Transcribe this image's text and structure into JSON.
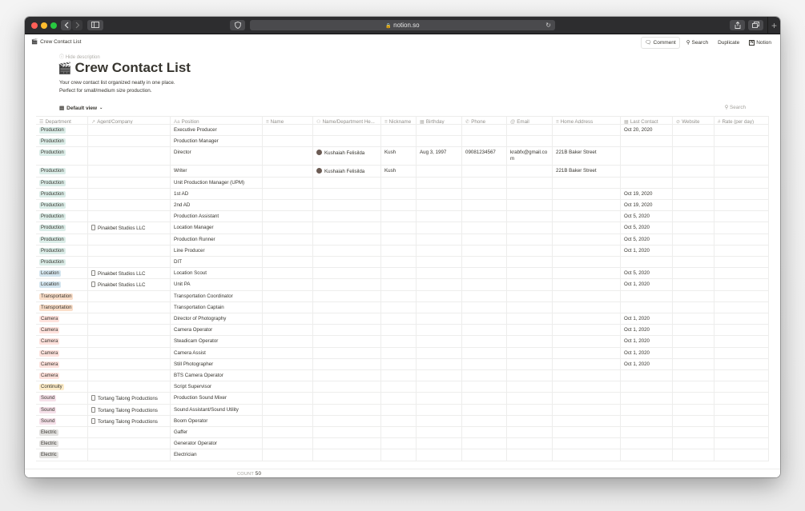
{
  "browser": {
    "url": "notion.so",
    "lock": "🔒"
  },
  "topbar": {
    "breadcrumb": "Crew Contact List",
    "breadcrumb_icon": "🎬",
    "comment": "Comment",
    "search": "Search",
    "duplicate": "Duplicate",
    "notion": "Notion"
  },
  "page": {
    "hide_description": "Hide description",
    "emoji": "🎬",
    "title": "Crew Contact List",
    "description_line1": "Your crew contact list organized neatly in one place.",
    "description_line2": "Perfect for small/medium size production.",
    "view": "Default view",
    "search": "Search"
  },
  "columns": [
    {
      "icon": "☰",
      "label": "Department"
    },
    {
      "icon": "↗",
      "label": "Agent/Company"
    },
    {
      "icon": "Aa",
      "label": "Position"
    },
    {
      "icon": "≡",
      "label": "Name"
    },
    {
      "icon": "⚇",
      "label": "Name/Department He..."
    },
    {
      "icon": "≡",
      "label": "Nickname"
    },
    {
      "icon": "▦",
      "label": "Birthday"
    },
    {
      "icon": "✆",
      "label": "Phone"
    },
    {
      "icon": "@",
      "label": "Email"
    },
    {
      "icon": "≡",
      "label": "Home Address"
    },
    {
      "icon": "▦",
      "label": "Last Contact"
    },
    {
      "icon": "⊘",
      "label": "Website"
    },
    {
      "icon": "#",
      "label": "Rate (per day)"
    }
  ],
  "rows": [
    {
      "dept": "Production",
      "dept_key": "production",
      "company": "",
      "position": "Executive Producer",
      "head": "",
      "nickname": "",
      "birthday": "",
      "phone": "",
      "email": "",
      "address": "",
      "last_contact": "Oct 20, 2020"
    },
    {
      "dept": "Production",
      "dept_key": "production",
      "company": "",
      "position": "Production Manager",
      "head": "",
      "nickname": "",
      "birthday": "",
      "phone": "",
      "email": "",
      "address": "",
      "last_contact": ""
    },
    {
      "dept": "Production",
      "dept_key": "production",
      "company": "",
      "position": "Director",
      "head": "Kushaiah Felisilda",
      "nickname": "Kush",
      "birthday": "Aug 3, 1997",
      "phone": "09081234567",
      "email": "krabfx@gmail.com",
      "address": "221B Baker Street",
      "last_contact": "",
      "tall": true
    },
    {
      "dept": "Production",
      "dept_key": "production",
      "company": "",
      "position": "Writer",
      "head": "Kushaiah Felisilda",
      "nickname": "Kush",
      "birthday": "",
      "phone": "",
      "email": "",
      "address": "221B Baker Street",
      "last_contact": ""
    },
    {
      "dept": "Production",
      "dept_key": "production",
      "company": "",
      "position": "Unit Production Manager (UPM)",
      "head": "",
      "nickname": "",
      "birthday": "",
      "phone": "",
      "email": "",
      "address": "",
      "last_contact": ""
    },
    {
      "dept": "Production",
      "dept_key": "production",
      "company": "",
      "position": "1st AD",
      "head": "",
      "nickname": "",
      "birthday": "",
      "phone": "",
      "email": "",
      "address": "",
      "last_contact": "Oct 19, 2020"
    },
    {
      "dept": "Production",
      "dept_key": "production",
      "company": "",
      "position": "2nd AD",
      "head": "",
      "nickname": "",
      "birthday": "",
      "phone": "",
      "email": "",
      "address": "",
      "last_contact": "Oct 19, 2020"
    },
    {
      "dept": "Production",
      "dept_key": "production",
      "company": "",
      "position": "Production Assistant",
      "head": "",
      "nickname": "",
      "birthday": "",
      "phone": "",
      "email": "",
      "address": "",
      "last_contact": "Oct 5, 2020"
    },
    {
      "dept": "Production",
      "dept_key": "production",
      "company": "Pinakbet Studios LLC",
      "position": "Location Manager",
      "head": "",
      "nickname": "",
      "birthday": "",
      "phone": "",
      "email": "",
      "address": "",
      "last_contact": "Oct 5, 2020"
    },
    {
      "dept": "Production",
      "dept_key": "production",
      "company": "",
      "position": "Production Runner",
      "head": "",
      "nickname": "",
      "birthday": "",
      "phone": "",
      "email": "",
      "address": "",
      "last_contact": "Oct 5, 2020"
    },
    {
      "dept": "Production",
      "dept_key": "production",
      "company": "",
      "position": "Line Producer",
      "head": "",
      "nickname": "",
      "birthday": "",
      "phone": "",
      "email": "",
      "address": "",
      "last_contact": "Oct 1, 2020"
    },
    {
      "dept": "Production",
      "dept_key": "production",
      "company": "",
      "position": "DIT",
      "head": "",
      "nickname": "",
      "birthday": "",
      "phone": "",
      "email": "",
      "address": "",
      "last_contact": ""
    },
    {
      "dept": "Location",
      "dept_key": "location",
      "company": "Pinakbet Studios LLC",
      "position": "Location Scout",
      "head": "",
      "nickname": "",
      "birthday": "",
      "phone": "",
      "email": "",
      "address": "",
      "last_contact": "Oct 5, 2020"
    },
    {
      "dept": "Location",
      "dept_key": "location",
      "company": "Pinakbet Studios LLC",
      "position": "Unit PA",
      "head": "",
      "nickname": "",
      "birthday": "",
      "phone": "",
      "email": "",
      "address": "",
      "last_contact": "Oct 1, 2020"
    },
    {
      "dept": "Transportation",
      "dept_key": "transportation",
      "company": "",
      "position": "Transportation Coordinator",
      "head": "",
      "nickname": "",
      "birthday": "",
      "phone": "",
      "email": "",
      "address": "",
      "last_contact": ""
    },
    {
      "dept": "Transportation",
      "dept_key": "transportation",
      "company": "",
      "position": "Transportation Captain",
      "head": "",
      "nickname": "",
      "birthday": "",
      "phone": "",
      "email": "",
      "address": "",
      "last_contact": ""
    },
    {
      "dept": "Camera",
      "dept_key": "camera",
      "company": "",
      "position": "Director of Photography",
      "head": "",
      "nickname": "",
      "birthday": "",
      "phone": "",
      "email": "",
      "address": "",
      "last_contact": "Oct 1, 2020"
    },
    {
      "dept": "Camera",
      "dept_key": "camera",
      "company": "",
      "position": "Camera Operator",
      "head": "",
      "nickname": "",
      "birthday": "",
      "phone": "",
      "email": "",
      "address": "",
      "last_contact": "Oct 1, 2020"
    },
    {
      "dept": "Camera",
      "dept_key": "camera",
      "company": "",
      "position": "Steadicam Operator",
      "head": "",
      "nickname": "",
      "birthday": "",
      "phone": "",
      "email": "",
      "address": "",
      "last_contact": "Oct 1, 2020"
    },
    {
      "dept": "Camera",
      "dept_key": "camera",
      "company": "",
      "position": "Camera Assist",
      "head": "",
      "nickname": "",
      "birthday": "",
      "phone": "",
      "email": "",
      "address": "",
      "last_contact": "Oct 1, 2020"
    },
    {
      "dept": "Camera",
      "dept_key": "camera",
      "company": "",
      "position": "Still Photographer",
      "head": "",
      "nickname": "",
      "birthday": "",
      "phone": "",
      "email": "",
      "address": "",
      "last_contact": "Oct 1, 2020"
    },
    {
      "dept": "Camera",
      "dept_key": "camera",
      "company": "",
      "position": "BTS Camera Operator",
      "head": "",
      "nickname": "",
      "birthday": "",
      "phone": "",
      "email": "",
      "address": "",
      "last_contact": ""
    },
    {
      "dept": "Continuity",
      "dept_key": "continuity",
      "company": "",
      "position": "Script Supervisor",
      "head": "",
      "nickname": "",
      "birthday": "",
      "phone": "",
      "email": "",
      "address": "",
      "last_contact": ""
    },
    {
      "dept": "Sound",
      "dept_key": "sound",
      "company": "Tortang Talong Productions",
      "position": "Production Sound Mixer",
      "head": "",
      "nickname": "",
      "birthday": "",
      "phone": "",
      "email": "",
      "address": "",
      "last_contact": ""
    },
    {
      "dept": "Sound",
      "dept_key": "sound",
      "company": "Tortang Talong Productions",
      "position": "Sound Assistant/Sound Utility",
      "head": "",
      "nickname": "",
      "birthday": "",
      "phone": "",
      "email": "",
      "address": "",
      "last_contact": ""
    },
    {
      "dept": "Sound",
      "dept_key": "sound",
      "company": "Tortang Talong Productions",
      "position": "Boom Operator",
      "head": "",
      "nickname": "",
      "birthday": "",
      "phone": "",
      "email": "",
      "address": "",
      "last_contact": ""
    },
    {
      "dept": "Electric",
      "dept_key": "electric",
      "company": "",
      "position": "Gaffer",
      "head": "",
      "nickname": "",
      "birthday": "",
      "phone": "",
      "email": "",
      "address": "",
      "last_contact": ""
    },
    {
      "dept": "Electric",
      "dept_key": "electric",
      "company": "",
      "position": "Generator Operator",
      "head": "",
      "nickname": "",
      "birthday": "",
      "phone": "",
      "email": "",
      "address": "",
      "last_contact": ""
    },
    {
      "dept": "Electric",
      "dept_key": "electric",
      "company": "",
      "position": "Electrician",
      "head": "",
      "nickname": "",
      "birthday": "",
      "phone": "",
      "email": "",
      "address": "",
      "last_contact": ""
    }
  ],
  "footer": {
    "count_label": "COUNT",
    "count_value": "50"
  }
}
